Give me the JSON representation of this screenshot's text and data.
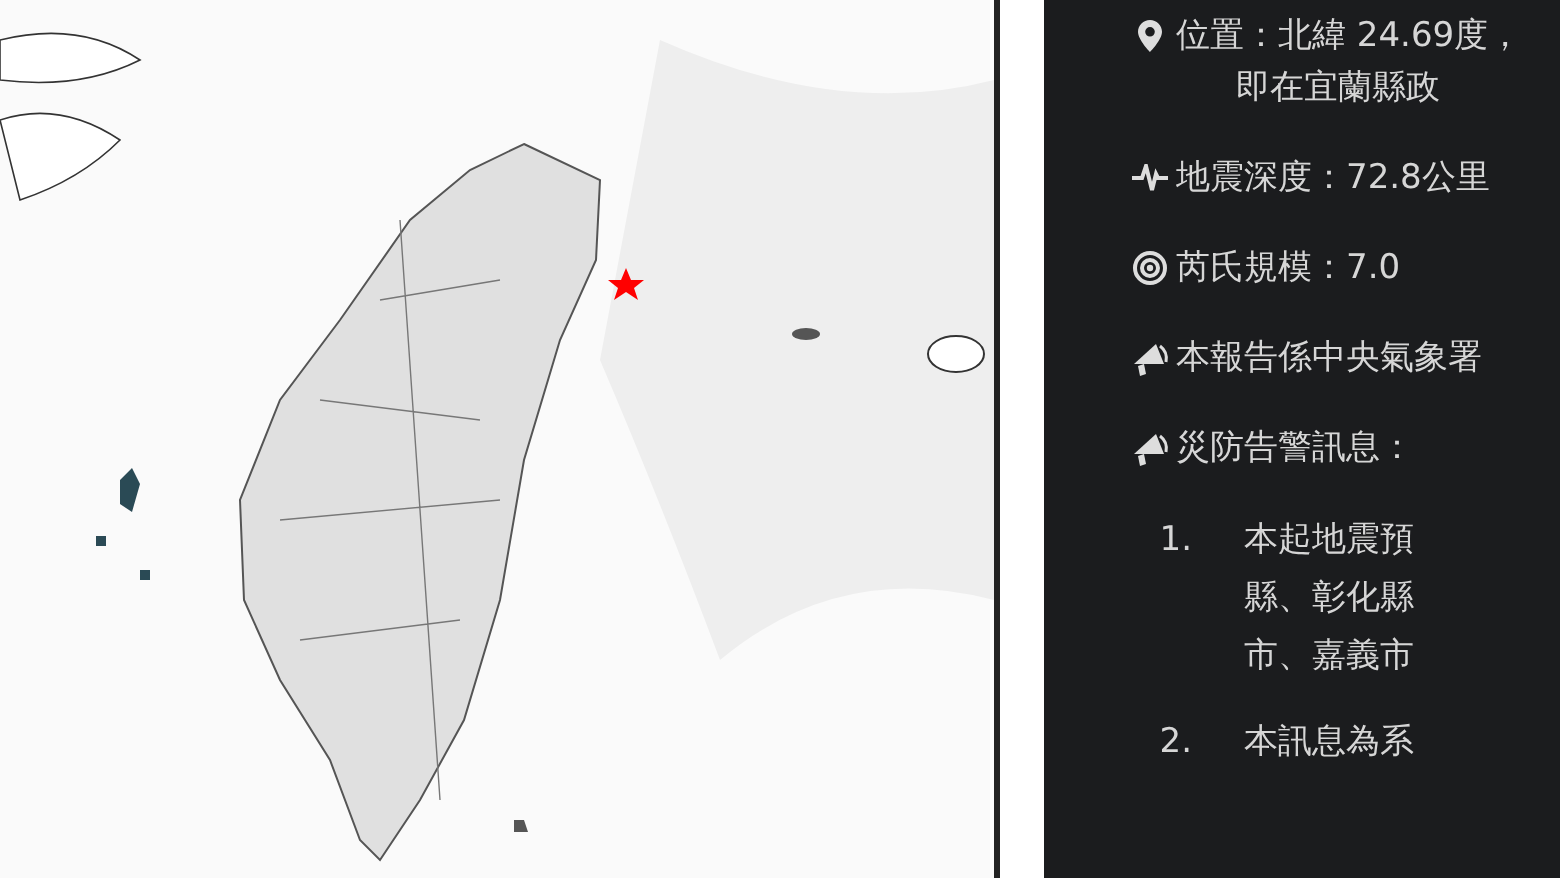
{
  "details": [
    {
      "kind": "location",
      "lines": [
        "位置：北緯 24.69度，",
        "即在宜蘭縣政"
      ]
    },
    {
      "kind": "depth",
      "lines": [
        "地震深度：72.8公里"
      ]
    },
    {
      "kind": "magnitude",
      "lines": [
        "芮氏規模：7.0"
      ]
    },
    {
      "kind": "notice",
      "lines": [
        "本報告係中央氣象署"
      ]
    },
    {
      "kind": "warning",
      "lines": [
        "災防告警訊息："
      ],
      "items": [
        {
          "number": "1.",
          "lines": [
            "本起地震預",
            "縣、彰化縣",
            "市、嘉義市"
          ]
        },
        {
          "number": "2.",
          "lines": [
            "本訊息為系"
          ]
        }
      ]
    }
  ]
}
